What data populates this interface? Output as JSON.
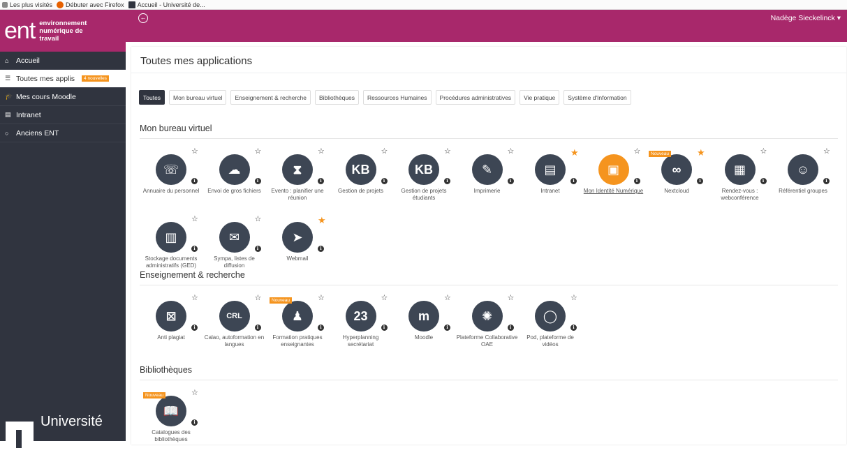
{
  "browser": {
    "bookmarks": [
      {
        "label": "Les plus visités"
      },
      {
        "label": "Débuter avec Firefox"
      },
      {
        "label": "Accueil - Université de..."
      }
    ]
  },
  "sidebar": {
    "logo": {
      "big": "ent",
      "small": "environnement numérique de travail"
    },
    "items": [
      {
        "label": "Accueil",
        "icon": "home-icon"
      },
      {
        "label": "Toutes mes applis",
        "icon": "list-icon",
        "badge": "4 nouvelles"
      },
      {
        "label": "Mes cours Moodle",
        "icon": "graduation-cap-icon"
      },
      {
        "label": "Intranet",
        "icon": "document-icon"
      },
      {
        "label": "Anciens ENT",
        "icon": "circle-icon"
      }
    ],
    "university": "Université"
  },
  "topbar": {
    "back_icon": "back-arrow-icon",
    "user": "Nadège Sieckelinck ▾"
  },
  "main": {
    "title": "Toutes mes applications",
    "filters": [
      "Toutes",
      "Mon bureau virtuel",
      "Enseignement & recherche",
      "Bibliothèques",
      "Ressources Humaines",
      "Procédures administratives",
      "Vie pratique",
      "Système d'Information"
    ],
    "active_filter": "Toutes",
    "new_label": "Nouveau",
    "sections": [
      {
        "title": "Mon bureau virtuel",
        "apps": [
          {
            "label": "Annuaire du personnel",
            "glyph": "☏",
            "favorite": false
          },
          {
            "label": "Envoi de gros fichiers",
            "glyph": "☁",
            "favorite": false
          },
          {
            "label": "Evento : planifier une réunion",
            "glyph": "⧗",
            "favorite": false
          },
          {
            "label": "Gestion de projets",
            "glyph": "KB",
            "favorite": false
          },
          {
            "label": "Gestion de projets étudiants",
            "glyph": "KB",
            "favorite": false
          },
          {
            "label": "Imprimerie",
            "glyph": "✎",
            "favorite": false
          },
          {
            "label": "Intranet",
            "glyph": "▤",
            "favorite": true
          },
          {
            "label": "Mon Identité Numérique",
            "glyph": "▣",
            "favorite": false,
            "highlight": true
          },
          {
            "label": "Nextcloud",
            "glyph": "∞",
            "favorite": true,
            "new": true
          },
          {
            "label": "Rendez-vous : webconférence",
            "glyph": "▦",
            "favorite": false
          },
          {
            "label": "Référentiel groupes",
            "glyph": "☺",
            "favorite": false
          },
          {
            "label": "Stockage documents administratifs (GED)",
            "glyph": "▥",
            "favorite": false
          },
          {
            "label": "Sympa, listes de diffusion",
            "glyph": "✉",
            "favorite": false
          },
          {
            "label": "Webmail",
            "glyph": "➤",
            "favorite": true
          }
        ]
      },
      {
        "title": "Enseignement & recherche",
        "apps": [
          {
            "label": "Anti plagiat",
            "glyph": "⊠",
            "favorite": false
          },
          {
            "label": "Calao, autoformation en langues",
            "glyph": "CRL",
            "favorite": false
          },
          {
            "label": "Formation pratiques enseignantes",
            "glyph": "♟",
            "favorite": false,
            "new": true
          },
          {
            "label": "Hyperplanning secrétariat",
            "glyph": "23",
            "favorite": false
          },
          {
            "label": "Moodle",
            "glyph": "m",
            "favorite": false
          },
          {
            "label": "Plateforme Collaborative OAE",
            "glyph": "✺",
            "favorite": false
          },
          {
            "label": "Pod, plateforme de vidéos",
            "glyph": "◯",
            "favorite": false
          }
        ]
      },
      {
        "title": "Bibliothèques",
        "apps": [
          {
            "label": "Catalogues des bibliothèques",
            "glyph": "📖",
            "favorite": false,
            "new": true
          }
        ]
      }
    ]
  },
  "colors": {
    "brand": "#a8286b",
    "sidebar": "#30343f",
    "icon_bg": "#3d4654",
    "accent": "#f5941e"
  }
}
